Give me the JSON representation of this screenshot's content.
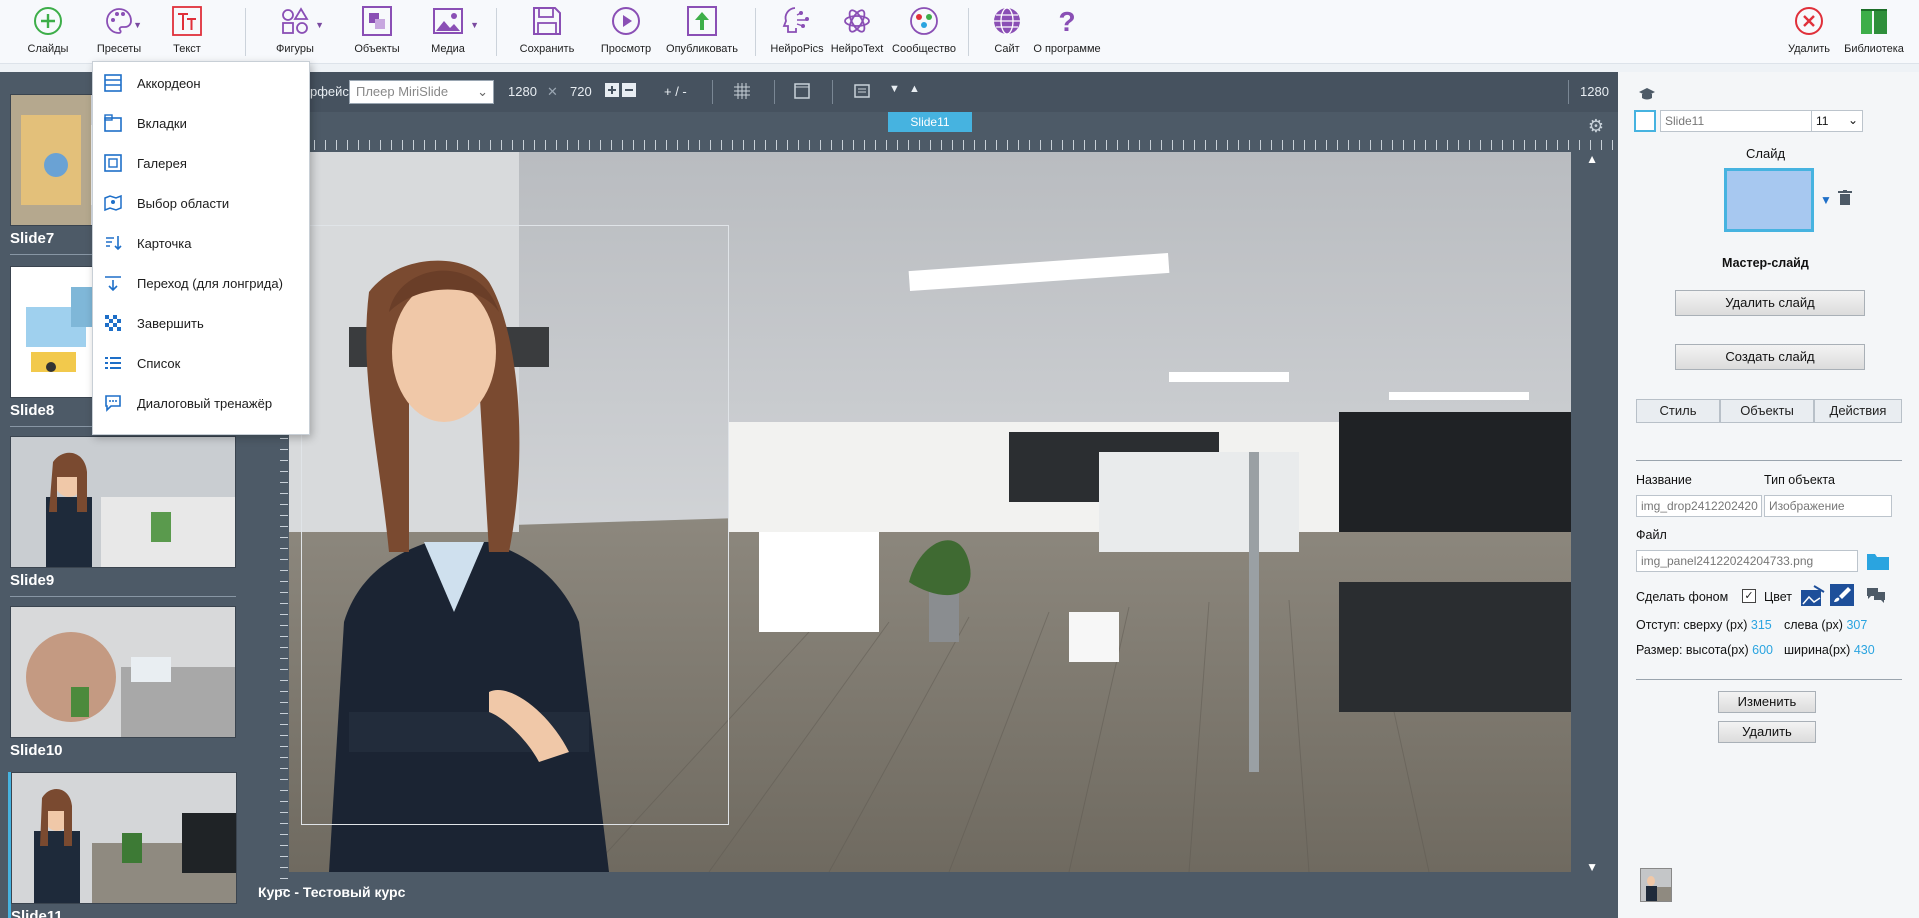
{
  "toolbar": {
    "slides": "Слайды",
    "presets": "Пресеты",
    "text": "Текст",
    "shapes": "Фигуры",
    "objects": "Объекты",
    "media": "Медиа",
    "save": "Сохранить",
    "preview": "Просмотр",
    "publish": "Опубликовать",
    "neuropics": "НейроPics",
    "neurotext": "НейроText",
    "community": "Сообщество",
    "site": "Сайт",
    "about": "О программе",
    "delete": "Удалить",
    "library": "Библиотека"
  },
  "presets_menu": [
    {
      "label": "Аккордеон",
      "icon": "accordion-icon"
    },
    {
      "label": "Вкладки",
      "icon": "tabs-icon"
    },
    {
      "label": "Галерея",
      "icon": "gallery-icon"
    },
    {
      "label": "Выбор области",
      "icon": "area-select-icon"
    },
    {
      "label": "Карточка",
      "icon": "card-icon"
    },
    {
      "label": "Переход (для лонгрида)",
      "icon": "transition-icon"
    },
    {
      "label": "Завершить",
      "icon": "finish-icon"
    },
    {
      "label": "Список",
      "icon": "list-icon"
    },
    {
      "label": "Диалоговый тренажёр",
      "icon": "dialog-trainer-icon"
    }
  ],
  "slides": [
    {
      "label": "Slide7"
    },
    {
      "label": "Slide8"
    },
    {
      "label": "Slide9"
    },
    {
      "label": "Slide10"
    },
    {
      "label": "Slide11"
    }
  ],
  "canvas": {
    "interface_label": "рфейс",
    "player_select": "Плеер MiriSlide",
    "width": "1280",
    "times": "✕",
    "height": "720",
    "zoom_label": "+  /  -",
    "right_width": "1280",
    "slide_tag": "Slide11",
    "course": "Курс -  Тестовый курс"
  },
  "panel": {
    "slide_name": "Slide11",
    "slide_number": "11",
    "slide_heading": "Слайд",
    "master_slide": "Мастер-слайд",
    "delete_slide": "Удалить слайд",
    "create_slide": "Создать слайд",
    "tabs": [
      "Стиль",
      "Объекты",
      "Действия"
    ],
    "name_label": "Название",
    "type_label": "Тип объекта",
    "name_value": "img_drop2412202420",
    "type_value": "Изображение",
    "file_label": "Файл",
    "file_value": "img_panel24122024204733.png",
    "make_bg": "Сделать фоном",
    "color": "Цвет",
    "offset_label": "Отступ:  сверху (px)",
    "offset_top": "315",
    "left_label": "слева (px)",
    "offset_left": "307",
    "size_label": "Размер: высота(px)",
    "size_height": "600",
    "width_label": "ширина(px)",
    "size_width": "430",
    "change": "Изменить",
    "remove": "Удалить"
  },
  "colors": {
    "accent": "#46b3e0",
    "dark_bg": "#4d5a67",
    "green_icon": "#3dae49",
    "purple_icon": "#8a4fb5",
    "red_icon": "#e0303a"
  }
}
